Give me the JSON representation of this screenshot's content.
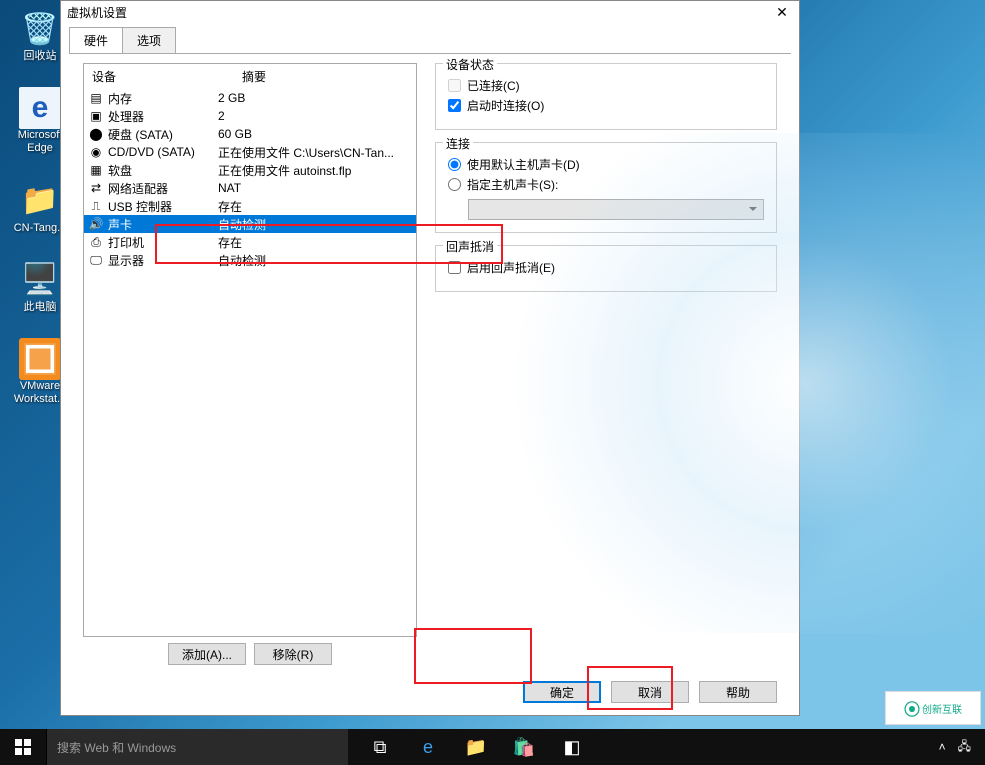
{
  "desktop": {
    "icons": [
      "回收站",
      "Microsoft Edge",
      "CN-Tang...",
      "此电脑",
      "VMware Workstat..."
    ]
  },
  "taskbar": {
    "search_placeholder": "搜索 Web 和 Windows"
  },
  "dialog": {
    "title": "虚拟机设置",
    "tabs": [
      "硬件",
      "选项"
    ],
    "columns": [
      "设备",
      "摘要"
    ],
    "devices": [
      {
        "name": "内存",
        "summary": "2 GB",
        "icon": "mem"
      },
      {
        "name": "处理器",
        "summary": "2",
        "icon": "cpu"
      },
      {
        "name": "硬盘 (SATA)",
        "summary": "60 GB",
        "icon": "disk"
      },
      {
        "name": "CD/DVD (SATA)",
        "summary": "正在使用文件 C:\\Users\\CN-Tan...",
        "icon": "cd"
      },
      {
        "name": "软盘",
        "summary": "正在使用文件 autoinst.flp",
        "icon": "floppy"
      },
      {
        "name": "网络适配器",
        "summary": "NAT",
        "icon": "net"
      },
      {
        "name": "USB 控制器",
        "summary": "存在",
        "icon": "usb"
      },
      {
        "name": "声卡",
        "summary": "自动检测",
        "icon": "sound",
        "selected": true
      },
      {
        "name": "打印机",
        "summary": "存在",
        "icon": "printer"
      },
      {
        "name": "显示器",
        "summary": "自动检测",
        "icon": "display"
      }
    ],
    "add_btn": "添加(A)...",
    "remove_btn": "移除(R)",
    "right": {
      "group_status": "设备状态",
      "connected": "已连接(C)",
      "connect_power": "启动时连接(O)",
      "group_conn": "连接",
      "use_default": "使用默认主机声卡(D)",
      "specify": "指定主机声卡(S):",
      "group_echo": "回声抵消",
      "enable_echo": "启用回声抵消(E)"
    },
    "ok": "确定",
    "cancel": "取消",
    "help": "帮助"
  },
  "watermark": "创新互联"
}
